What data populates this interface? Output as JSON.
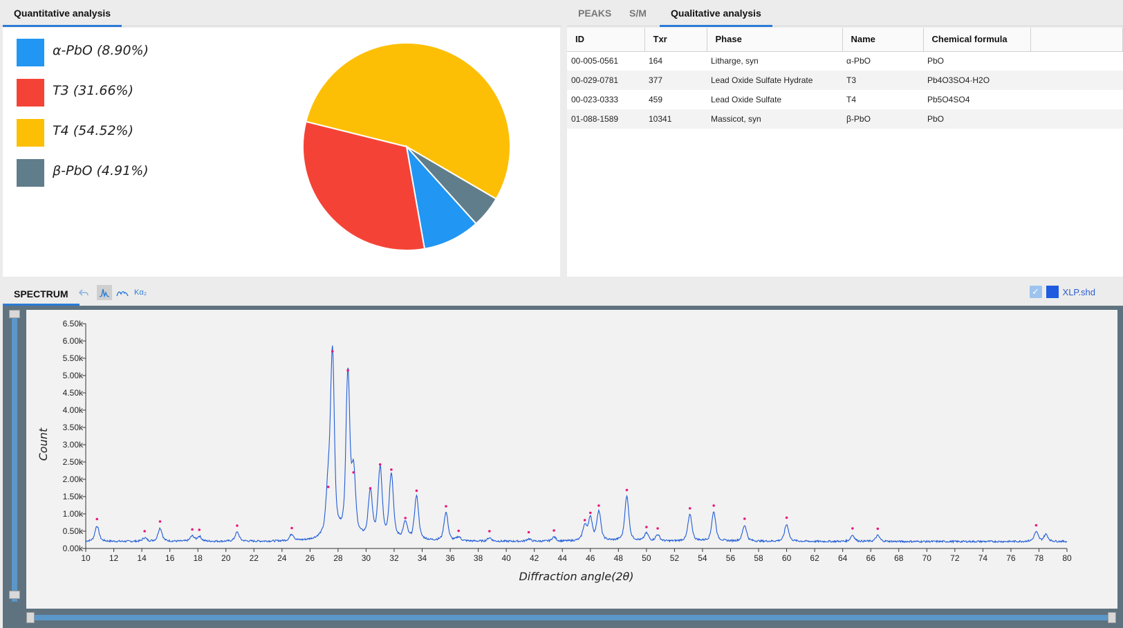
{
  "quant_panel": {
    "tab_label": "Quantitative analysis"
  },
  "chart_data": [
    {
      "type": "pie",
      "legend_position": "left",
      "slices": [
        {
          "label": "α-PbO (8.90%)",
          "name": "α-PbO",
          "value": 8.9,
          "color": "#2196f3"
        },
        {
          "label": "T3 (31.66%)",
          "name": "T3",
          "value": 31.66,
          "color": "#f44336"
        },
        {
          "label": "T4 (54.52%)",
          "name": "T4",
          "value": 54.52,
          "color": "#fdbf05"
        },
        {
          "label": "β-PbO (4.91%)",
          "name": "β-PbO",
          "value": 4.91,
          "color": "#607d8b"
        }
      ]
    },
    {
      "type": "line",
      "xlabel": "Diffraction angle(2θ)",
      "ylabel": "Count",
      "xlim": [
        10,
        80
      ],
      "ylim": [
        0,
        6500
      ],
      "x_ticks": [
        10,
        12,
        14,
        16,
        18,
        20,
        22,
        24,
        26,
        28,
        30,
        32,
        34,
        36,
        38,
        40,
        42,
        44,
        46,
        48,
        50,
        52,
        54,
        56,
        58,
        60,
        62,
        64,
        66,
        68,
        70,
        72,
        74,
        76,
        78,
        80
      ],
      "y_ticks": [
        "0.00k",
        "0.50k",
        "1.00k",
        "1.50k",
        "2.00k",
        "2.50k",
        "3.00k",
        "3.50k",
        "4.00k",
        "4.50k",
        "5.00k",
        "5.50k",
        "6.00k",
        "6.50k"
      ],
      "y_tick_values": [
        0,
        500,
        1000,
        1500,
        2000,
        2500,
        3000,
        3500,
        4000,
        4500,
        5000,
        5500,
        6000,
        6500
      ],
      "grid": false,
      "line_color": "#1f5bd6",
      "marker_color": "#e8187a",
      "baseline": 200,
      "peaks": [
        {
          "x": 10.8,
          "y": 650
        },
        {
          "x": 14.2,
          "y": 300
        },
        {
          "x": 15.3,
          "y": 580
        },
        {
          "x": 17.6,
          "y": 350
        },
        {
          "x": 18.1,
          "y": 340
        },
        {
          "x": 20.8,
          "y": 460
        },
        {
          "x": 24.7,
          "y": 390
        },
        {
          "x": 27.3,
          "y": 1580
        },
        {
          "x": 27.6,
          "y": 5500
        },
        {
          "x": 28.7,
          "y": 4950
        },
        {
          "x": 29.1,
          "y": 2000
        },
        {
          "x": 30.3,
          "y": 1540
        },
        {
          "x": 31.0,
          "y": 2230
        },
        {
          "x": 31.8,
          "y": 2080
        },
        {
          "x": 32.8,
          "y": 680
        },
        {
          "x": 33.6,
          "y": 1470
        },
        {
          "x": 35.7,
          "y": 1020
        },
        {
          "x": 36.6,
          "y": 310
        },
        {
          "x": 38.8,
          "y": 300
        },
        {
          "x": 41.6,
          "y": 270
        },
        {
          "x": 43.4,
          "y": 320
        },
        {
          "x": 45.6,
          "y": 620
        },
        {
          "x": 46.0,
          "y": 830
        },
        {
          "x": 46.6,
          "y": 1040
        },
        {
          "x": 48.6,
          "y": 1490
        },
        {
          "x": 50.0,
          "y": 420
        },
        {
          "x": 50.8,
          "y": 380
        },
        {
          "x": 53.1,
          "y": 960
        },
        {
          "x": 54.8,
          "y": 1040
        },
        {
          "x": 57.0,
          "y": 660
        },
        {
          "x": 60.0,
          "y": 690
        },
        {
          "x": 64.7,
          "y": 380
        },
        {
          "x": 66.5,
          "y": 370
        },
        {
          "x": 77.8,
          "y": 470
        },
        {
          "x": 78.5,
          "y": 400
        }
      ],
      "marked_peaks": [
        10.8,
        14.2,
        15.3,
        17.6,
        18.1,
        20.8,
        24.7,
        27.3,
        27.6,
        28.7,
        29.1,
        30.3,
        31.0,
        31.8,
        32.8,
        33.6,
        35.7,
        36.6,
        38.8,
        41.6,
        43.4,
        45.6,
        46.0,
        46.6,
        48.6,
        50.0,
        50.8,
        53.1,
        54.8,
        57.0,
        60.0,
        64.7,
        66.5,
        77.8
      ]
    }
  ],
  "qual_panel": {
    "tabs": [
      {
        "label": "PEAKS",
        "active": false
      },
      {
        "label": "S/M",
        "active": false
      },
      {
        "label": "Qualitative analysis",
        "active": true
      }
    ],
    "columns": [
      "ID",
      "Txr",
      "Phase",
      "Name",
      "Chemical formula"
    ],
    "rows": [
      [
        "00-005-0561",
        "164",
        "Litharge, syn",
        "α-PbO",
        "PbO"
      ],
      [
        "00-029-0781",
        "377",
        "Lead Oxide Sulfate Hydrate",
        "T3",
        "Pb4O3SO4·H2O"
      ],
      [
        "00-023-0333",
        "459",
        "Lead Oxide Sulfate",
        "T4",
        "Pb5O4SO4"
      ],
      [
        "01-088-1589",
        "10341",
        "Massicot, syn",
        "β-PbO",
        "PbO"
      ]
    ]
  },
  "spectrum_panel": {
    "tab_label": "SPECTRUM",
    "tools": [
      {
        "icon": "undo-icon"
      },
      {
        "icon": "peak-line-icon",
        "active": true
      },
      {
        "icon": "smooth-icon"
      },
      {
        "icon": "ka2-icon",
        "label": "Kα₂"
      }
    ],
    "file": {
      "label": "XLP.shd",
      "checked": true,
      "color": "#1e5be0"
    }
  }
}
